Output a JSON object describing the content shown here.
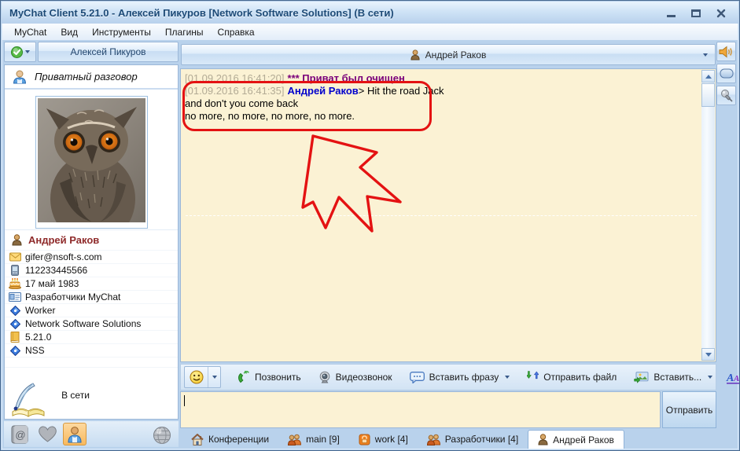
{
  "window": {
    "title": "MyChat Client 5.21.0 - Алексей Пикуров [Network Software Solutions] (В сети)"
  },
  "menu": {
    "items": [
      "MyChat",
      "Вид",
      "Инструменты",
      "Плагины",
      "Справка"
    ]
  },
  "sidebar": {
    "self_name": "Алексей Пикуров",
    "private_label": "Приватный разговор",
    "contact_name": "Андрей Раков",
    "details": [
      {
        "icon": "email-icon",
        "value": "gifer@nsoft-s.com"
      },
      {
        "icon": "phone-icon",
        "value": "112233445566"
      },
      {
        "icon": "birthday-icon",
        "value": "17 май 1983"
      },
      {
        "icon": "idcard-icon",
        "value": "Разработчики MyChat"
      },
      {
        "icon": "info-icon",
        "value": "Worker"
      },
      {
        "icon": "info-icon",
        "value": "Network Software Solutions"
      },
      {
        "icon": "version-icon",
        "value": "5.21.0"
      },
      {
        "icon": "info-icon",
        "value": "NSS"
      }
    ],
    "status_text": "В сети"
  },
  "chat": {
    "header_title": "Андрей Раков",
    "messages": [
      {
        "time": "[01.09.2016 16:41:20]",
        "system": "*** Приват был очищен"
      },
      {
        "time": "[01.09.2016 16:41:35]",
        "author": "Андрей Раков",
        "text": "> Hit the road Jack",
        "line2": "and don't you come back",
        "line3": "no more, no more, no more, no more."
      }
    ]
  },
  "toolbar": {
    "call": "Позвонить",
    "video": "Видеозвонок",
    "phrase": "Вставить фразу",
    "send_file": "Отправить файл",
    "insert": "Вставить..."
  },
  "composer": {
    "send_label": "Отправить"
  },
  "tabs": [
    {
      "label": "Конференции"
    },
    {
      "label": "main [9]"
    },
    {
      "label": "work [4]"
    },
    {
      "label": "Разработчики [4]"
    },
    {
      "label": "Андрей Раков"
    }
  ],
  "colors": {
    "annotation_red": "#e41212",
    "chat_background": "#fbf2d4",
    "selected_orange": "#f8b95e",
    "author_blue": "#0000cc",
    "system_purple": "#7a007a",
    "contact_red": "#8f2b2b"
  }
}
